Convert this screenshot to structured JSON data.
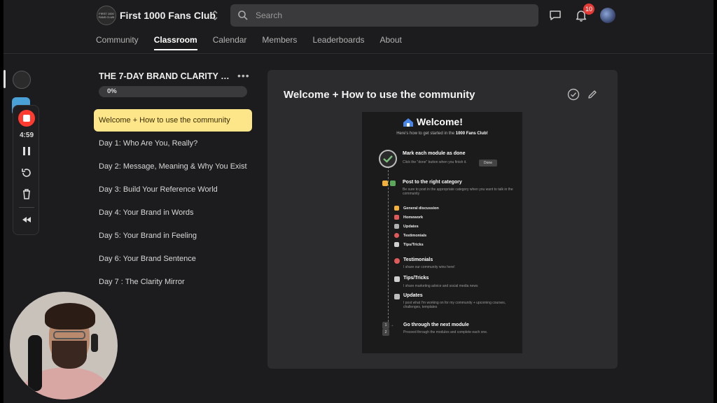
{
  "header": {
    "group_logo_text": "FIRST 1000 FANS CLUB",
    "group_name": "First 1000 Fans Club",
    "search_placeholder": "Search",
    "notifications_count": "10"
  },
  "tabs": [
    {
      "label": "Community",
      "active": false
    },
    {
      "label": "Classroom",
      "active": true
    },
    {
      "label": "Calendar",
      "active": false
    },
    {
      "label": "Members",
      "active": false
    },
    {
      "label": "Leaderboards",
      "active": false
    },
    {
      "label": "About",
      "active": false
    }
  ],
  "recorder": {
    "time": "4:59",
    "record_color": "#ff3b30"
  },
  "course": {
    "title": "THE 7-DAY BRAND CLARITY CH...",
    "progress_label": "0%",
    "progress_fraction": 0,
    "lessons": [
      {
        "label": "Welcome + How to use the community",
        "active": true
      },
      {
        "label": "Day 1: Who Are You, Really?",
        "active": false
      },
      {
        "label": "Day 2: Message, Meaning & Why You Exist",
        "active": false
      },
      {
        "label": "Day 3: Build Your Reference World",
        "active": false
      },
      {
        "label": "Day 4: Your Brand in Words",
        "active": false
      },
      {
        "label": "Day 5: Your Brand in Feeling",
        "active": false
      },
      {
        "label": "Day 6: Your Brand Sentence",
        "active": false
      },
      {
        "label": "Day 7 : The Clarity Mirror",
        "active": false
      }
    ],
    "active_color": "#fde68a"
  },
  "content": {
    "title": "Welcome + How to use the community",
    "image": {
      "title": "Welcome!",
      "subtitle_prefix": "Here's how to get started in the ",
      "subtitle_bold": "1000 Fans Club!",
      "step1_title": "Mark each module as done",
      "step1_text": "Click the \"done\" button when you finish it.",
      "done_label": "Done",
      "step2_title": "Post to the right category",
      "step2_text": "Be sure to post in the appropriate category when you want to talk in the community",
      "categories": [
        "General discussion",
        "Homework",
        "Updates",
        "Testimonials",
        "Tips/Tricks"
      ],
      "testimonials_title": "Testimonials",
      "testimonials_text": "I share our community wins here!",
      "tips_title": "Tips/Tricks",
      "tips_text": "I share marketing advice and social media news",
      "updates_title": "Updates",
      "updates_text": "I post what I'm working on for my community + upcoming courses, challenges, templates",
      "step3_num_a": "1",
      "step3_num_b": "2",
      "step3_title": "Go through the next module",
      "step3_text": "Proceed through the modules and complete each one."
    }
  }
}
